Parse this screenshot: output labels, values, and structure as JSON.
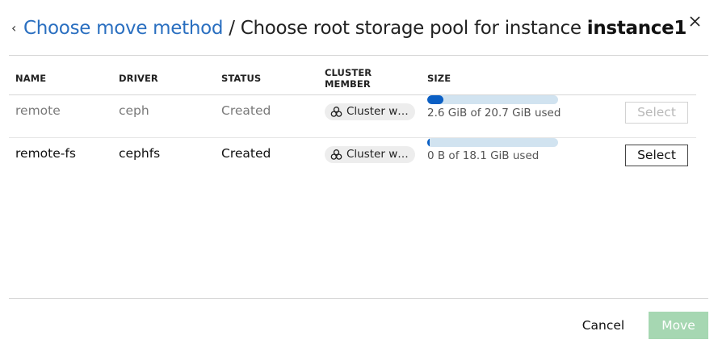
{
  "header": {
    "back_icon": "chevron-left-icon",
    "link_text": "Choose move method",
    "separator": "/",
    "title_text": "Choose root storage pool for instance",
    "instance_name": "instance1",
    "close_icon": "close-icon",
    "link_color": "#2a6fc0"
  },
  "table": {
    "columns": [
      "NAME",
      "DRIVER",
      "STATUS",
      "CLUSTER MEMBER",
      "SIZE"
    ],
    "rows": [
      {
        "name": "remote",
        "driver": "ceph",
        "status": "Created",
        "cluster_member": "Cluster wide",
        "cluster_icon": "cluster-icon",
        "usage_fraction": 0.125,
        "size_text": "2.6 GiB of 20.7 GiB used",
        "action_label": "Select",
        "disabled": true
      },
      {
        "name": "remote-fs",
        "driver": "cephfs",
        "status": "Created",
        "cluster_member": "Cluster wide",
        "cluster_icon": "cluster-icon",
        "usage_fraction": 0.02,
        "size_text": "0 B of 18.1 GiB used",
        "action_label": "Select",
        "disabled": false
      }
    ]
  },
  "footer": {
    "cancel_label": "Cancel",
    "move_label": "Move",
    "move_color": "#a6d7b2"
  },
  "colors": {
    "meter_track": "#d1e3f0",
    "meter_fill": "#0b5fc4"
  }
}
